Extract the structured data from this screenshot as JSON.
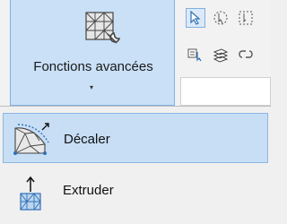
{
  "ribbon": {
    "advanced_functions": {
      "label": "Fonctions avancées",
      "icon": "mesh-wrench-icon",
      "caret": "▾"
    },
    "toolbar_icons": [
      "select-arrow-icon",
      "select-circle-icon",
      "select-more-icon",
      "select-layer-icon",
      "layers-icon",
      "link-icon"
    ]
  },
  "dropdown": {
    "items": [
      {
        "label": "Décaler",
        "icon": "offset-mesh-icon",
        "highlighted": true
      },
      {
        "label": "Extruder",
        "icon": "extrude-mesh-icon",
        "highlighted": false
      }
    ]
  },
  "colors": {
    "highlight_fill": "#c9e0f7",
    "highlight_border": "#7fb0e0",
    "icon_blue": "#2f6fb6"
  }
}
